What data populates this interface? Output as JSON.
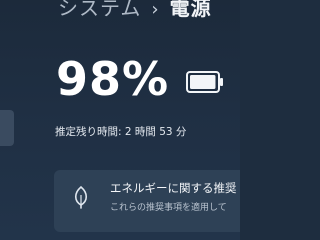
{
  "header": {
    "parent": "システム",
    "separator": "›",
    "current": "電源"
  },
  "battery": {
    "percent_label": "98%",
    "level": 0.98,
    "estimate_label": "推定残り時間: 2 時間 53 分"
  },
  "recommendation_card": {
    "title": "エネルギーに関する推奨",
    "subtitle": "これらの推奨事項を適用して",
    "icon": "leaf-icon"
  },
  "colors": {
    "background": "#1e2d3f",
    "card": "#2e4156",
    "text": "#ffffff"
  }
}
